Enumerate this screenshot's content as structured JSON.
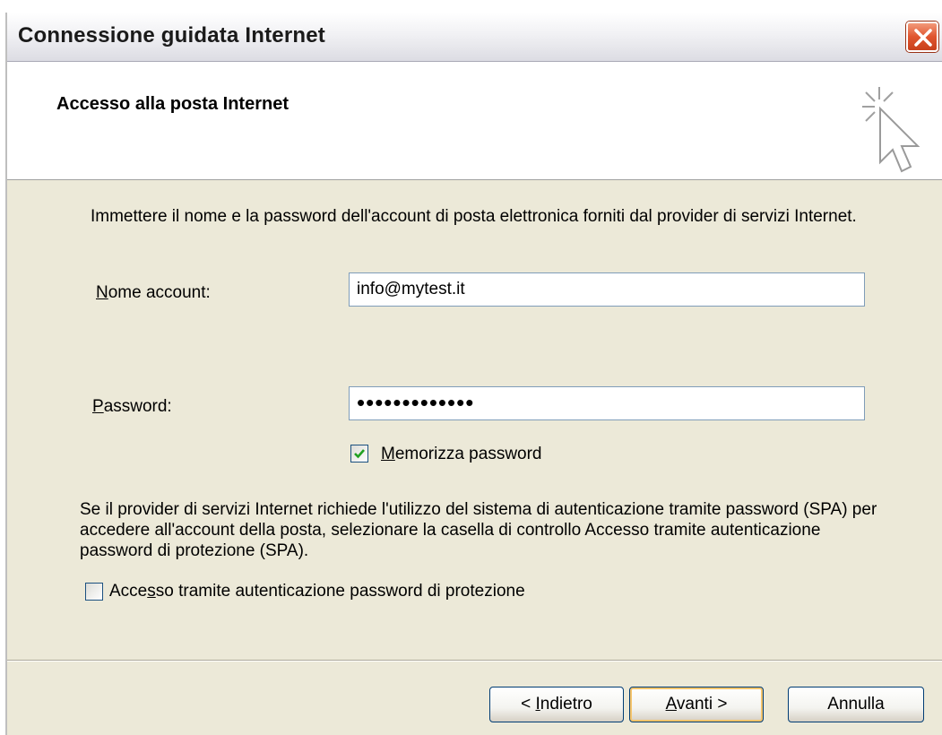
{
  "window": {
    "title": "Connessione guidata Internet"
  },
  "header": {
    "title": "Accesso alla posta Internet",
    "icon": "wizard-cursor-icon"
  },
  "form": {
    "instructions": "Immettere il nome e la password dell'account di posta elettronica forniti dal provider di servizi Internet.",
    "account_label_u": "N",
    "account_label_rest": "ome account:",
    "account_value": "info@mytest.it",
    "password_label_u": "P",
    "password_label_rest": "assword:",
    "password_value": "•••••••••••••",
    "remember_u": "M",
    "remember_rest": "emorizza password",
    "remember_checked": true,
    "spa_text": "Se il provider di servizi Internet richiede l'utilizzo del sistema di autenticazione tramite password (SPA) per accedere all'account della posta, selezionare la casella di controllo Accesso tramite autenticazione password di protezione (SPA).",
    "spa_label_a": "Acce",
    "spa_label_u": "s",
    "spa_label_b": "so tramite autenticazione password di protezione",
    "spa_checked": false
  },
  "buttons": {
    "back_a": "< ",
    "back_u": "I",
    "back_b": "ndietro",
    "next_u": "A",
    "next_b": "vanti >",
    "cancel": "Annulla"
  },
  "colors": {
    "window_bg": "#ece9d8",
    "close_red": "#e0552f",
    "check_green": "#21a121"
  }
}
